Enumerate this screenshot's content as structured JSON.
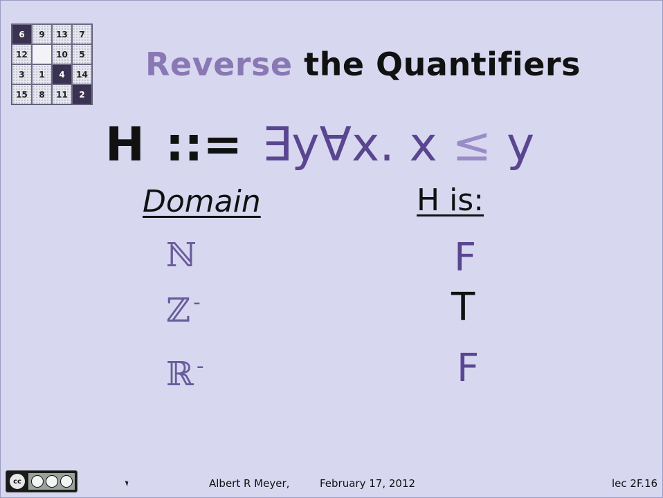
{
  "puzzle": {
    "tiles": [
      {
        "label": "6",
        "style": "dark"
      },
      {
        "label": "9",
        "style": "light"
      },
      {
        "label": "13",
        "style": "light"
      },
      {
        "label": "7",
        "style": "light"
      },
      {
        "label": "12",
        "style": "light"
      },
      {
        "label": "",
        "style": "blank"
      },
      {
        "label": "10",
        "style": "light"
      },
      {
        "label": "5",
        "style": "light"
      },
      {
        "label": "3",
        "style": "light"
      },
      {
        "label": "1",
        "style": "light"
      },
      {
        "label": "4",
        "style": "dark"
      },
      {
        "label": "14",
        "style": "light"
      },
      {
        "label": "15",
        "style": "light"
      },
      {
        "label": "8",
        "style": "light"
      },
      {
        "label": "11",
        "style": "light"
      },
      {
        "label": "2",
        "style": "dark"
      }
    ]
  },
  "title": {
    "accent": "Reverse",
    "rest": "the Quantifiers"
  },
  "formula": {
    "lhs": "H",
    "def": "::=",
    "body_start": "∃y∀x. x ",
    "leq": "≤",
    "body_end": " y"
  },
  "table": {
    "domain_header": "Domain",
    "value_header": "H is:",
    "rows": [
      {
        "domain": "ℕ",
        "superscript": "",
        "value": "F"
      },
      {
        "domain": "ℤ",
        "superscript": "-",
        "value": "T"
      },
      {
        "domain": "ℝ",
        "superscript": "-",
        "value": "F"
      }
    ]
  },
  "footer": {
    "license_badge": "cc",
    "author": "Albert R Meyer,",
    "date": "February 17, 2012",
    "lecture": "lec 2F.16"
  },
  "colors": {
    "background": "#d7d8f0",
    "accent_purple": "#8a78b4",
    "formula_purple": "#5a4690",
    "leq_lavender": "#9a8cc6",
    "domain_purple": "#6a5c9c",
    "text_black": "#111111"
  }
}
